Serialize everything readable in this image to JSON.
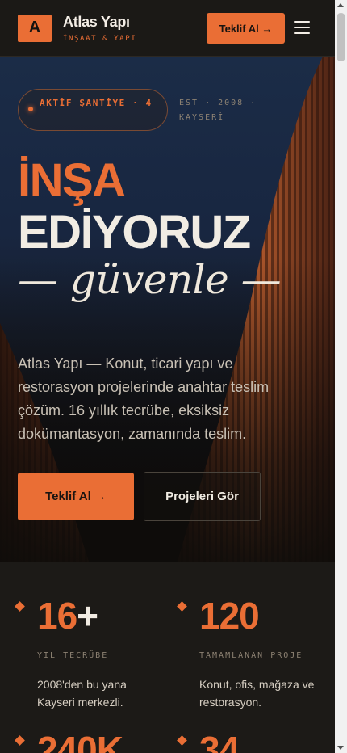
{
  "header": {
    "logo_letter": "A",
    "brand_name": "Atlas Yapı",
    "brand_sub": "İNŞAAT & YAPI",
    "cta_label": "Teklif Al →",
    "menu_icon": "hamburger-menu-icon"
  },
  "hero": {
    "badge": "AKTİF ŞANTİYE · 4",
    "est": "EST · 2008 · KAYSERİ",
    "title_line1": "İNŞA",
    "title_line2": "EDİYORUZ",
    "title_line3": "— güvenle —",
    "description": "Atlas Yapı — Konut, ticari yapı ve restorasyon projelerinde anahtar teslim çözüm. 16 yıllık tecrübe, eksiksiz dokümantasyon, zamanında teslim.",
    "primary_button": "Teklif Al →",
    "secondary_button": "Projeleri Gör"
  },
  "stats": [
    {
      "number": "16",
      "suffix": "+",
      "label": "YIL TECRÜBE",
      "sub": "2008'den bu yana Kayseri merkezli."
    },
    {
      "number": "120",
      "suffix": "",
      "label": "TAMAMLANAN PROJE",
      "sub": "Konut, ofis, mağaza ve restorasyon."
    },
    {
      "number": "240K",
      "suffix": "",
      "label": "",
      "sub": ""
    },
    {
      "number": "34",
      "suffix": "",
      "label": "",
      "sub": ""
    }
  ],
  "colors": {
    "accent": "#ea6e35",
    "background": "#1c1a17",
    "hero_sky": "#1b2c47"
  }
}
